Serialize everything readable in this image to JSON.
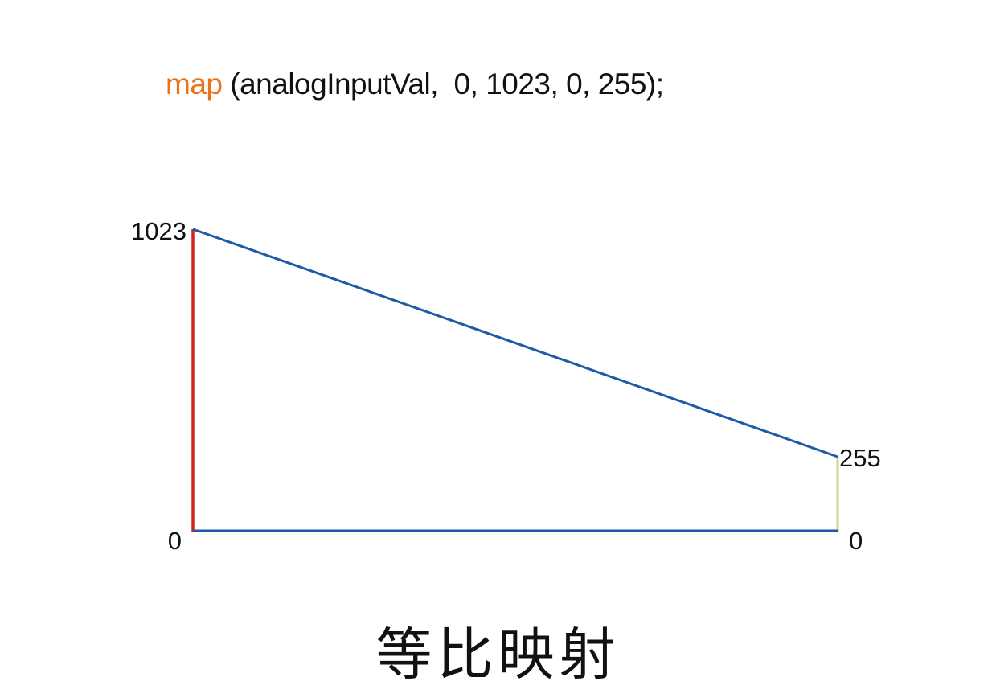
{
  "code": {
    "function_name": "map",
    "arguments": " (analogInputVal,  0, 1023, 0, 255);"
  },
  "diagram": {
    "input_range": {
      "max_label": "1023",
      "min_label": "0"
    },
    "output_range": {
      "max_label": "255",
      "min_label": "0"
    },
    "colors": {
      "input_axis": "#d0281e",
      "output_axis": "#c8d98a",
      "mapping_lines": "#1f5aa6",
      "function_name": "#e8731a"
    }
  },
  "caption": "等比映射"
}
